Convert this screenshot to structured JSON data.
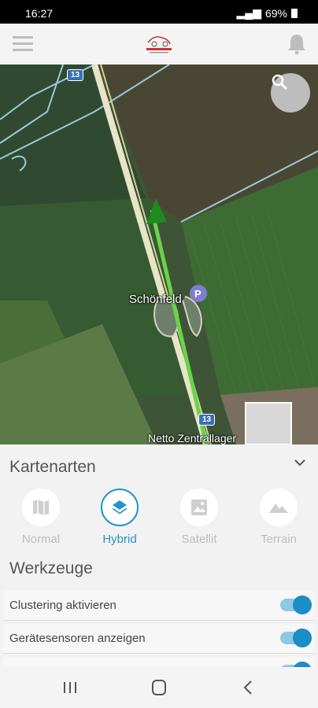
{
  "status_bar": {
    "time": "16:27",
    "battery": "69%"
  },
  "app": {
    "logo_name": "logo"
  },
  "map": {
    "labels": {
      "place": "Schönfeld",
      "poi": "Netto Zentrallager",
      "road_top": "13",
      "road_bottom": "13"
    },
    "colors": {
      "route": "#6bd34a",
      "marker": "#1f8a1f",
      "parking": "#7b7fd0"
    }
  },
  "panel": {
    "map_types_title": "Kartenarten",
    "map_types": [
      {
        "label": "Normal",
        "icon": "map-icon",
        "active": false
      },
      {
        "label": "Hybrid",
        "icon": "layers-icon",
        "active": true
      },
      {
        "label": "Satellit",
        "icon": "image-icon",
        "active": false
      },
      {
        "label": "Terrain",
        "icon": "terrain-icon",
        "active": false
      }
    ],
    "tools_title": "Werkzeuge",
    "tools": [
      {
        "label": "Clustering aktivieren",
        "on": true
      },
      {
        "label": "Gerätesensoren anzeigen",
        "on": true
      }
    ]
  },
  "colors": {
    "accent": "#2196c9",
    "inactive": "#bdbdbd"
  }
}
